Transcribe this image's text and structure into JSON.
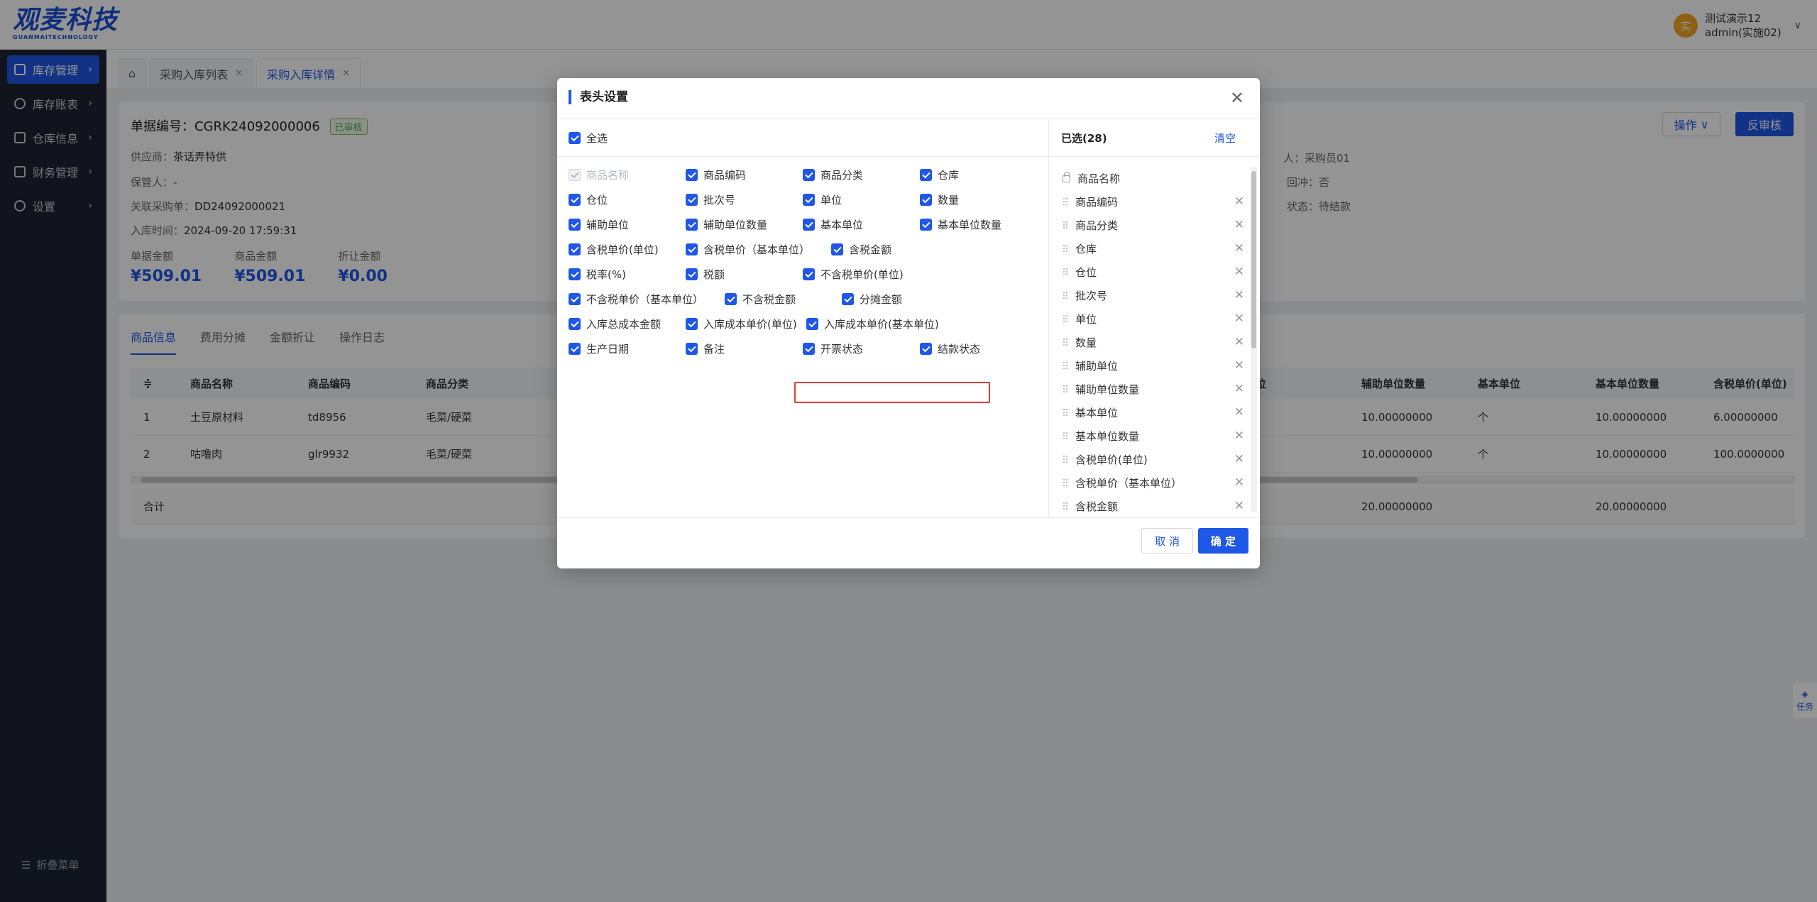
{
  "logo": {
    "cn": "观麦科技",
    "en": "GUANMAITECHNOLOGY"
  },
  "user": {
    "avatar": "实",
    "name": "测试演示12",
    "account": "admin(实施02)"
  },
  "sidebar": {
    "items": [
      {
        "label": "库存管理",
        "icon": "warehouse-icon",
        "active": true
      },
      {
        "label": "库存账表",
        "icon": "chart-icon"
      },
      {
        "label": "仓库信息",
        "icon": "store-icon"
      },
      {
        "label": "财务管理",
        "icon": "finance-icon"
      },
      {
        "label": "设置",
        "icon": "gear-icon"
      }
    ],
    "fold_label": "折叠菜单"
  },
  "tabs": [
    {
      "label": "采购入库列表"
    },
    {
      "label": "采购入库详情",
      "active": true
    }
  ],
  "info": {
    "title": "单据编号：CGRK24092000006",
    "status": "已审核",
    "supplier": "供应商：",
    "supplier_val": "茶话弄特供",
    "keeper": "保管人：-",
    "order_label": "关联采购单：",
    "order_val": "DD24092000021",
    "time_label": "入库时间：",
    "time_val": "2024-09-20 17:59:31",
    "amounts": [
      {
        "label": "单据金额",
        "value": "¥509.01"
      },
      {
        "label": "商品金额",
        "value": "¥509.01"
      },
      {
        "label": "折让金额",
        "value": "¥0.00"
      }
    ],
    "right": {
      "buyer": "人：采购员01",
      "reverse": "回冲：否",
      "settle": "状态：待结款"
    },
    "op_button": "操作",
    "reaudit_button": "反审核"
  },
  "detail": {
    "tabs": [
      "商品信息",
      "费用分摊",
      "金额折让",
      "操作日志"
    ],
    "columns": [
      "商品名称",
      "商品编码",
      "商品分类",
      "单位",
      "辅助单位数量",
      "基本单位",
      "基本单位数量",
      "含税单价(单位)"
    ],
    "rows": [
      {
        "idx": "1",
        "name": "土豆原材料",
        "code": "td8956",
        "cat": "毛菜/硬菜",
        "aux": "10.00000000",
        "base": "个",
        "basenum": "10.00000000",
        "price": "6.00000000"
      },
      {
        "idx": "2",
        "name": "咕噜肉",
        "code": "glr9932",
        "cat": "毛菜/硬菜",
        "aux": "10.00000000",
        "base": "个",
        "basenum": "10.00000000",
        "price": "100.0000000"
      }
    ],
    "total_label": "合计",
    "total_aux": "20.00000000",
    "total_base": "20.00000000"
  },
  "modal": {
    "title": "表头设置",
    "select_all": "全选",
    "options": [
      {
        "label": "商品名称",
        "disabled": true
      },
      {
        "label": "商品编码"
      },
      {
        "label": "商品分类"
      },
      {
        "label": "仓库"
      },
      {
        "label": "仓位"
      },
      {
        "label": "批次号"
      },
      {
        "label": "单位"
      },
      {
        "label": "数量"
      },
      {
        "label": "辅助单位"
      },
      {
        "label": "辅助单位数量"
      },
      {
        "label": "基本单位"
      },
      {
        "label": "基本单位数量"
      },
      {
        "label": "含税单价(单位)"
      },
      {
        "label": "含税单价（基本单位）"
      },
      {
        "label": "含税金额"
      },
      {
        "label": "税率(%)"
      },
      {
        "label": "税额"
      },
      {
        "label": "不含税单价(单位)"
      },
      {
        "label": "不含税单价（基本单位）"
      },
      {
        "label": "不含税金额"
      },
      {
        "label": "分摊金额"
      },
      {
        "label": "入库总成本金额"
      },
      {
        "label": "入库成本单价(单位)"
      },
      {
        "label": "入库成本单价(基本单位)"
      },
      {
        "label": "生产日期"
      },
      {
        "label": "备注"
      },
      {
        "label": "开票状态"
      },
      {
        "label": "结款状态"
      }
    ],
    "selected_count": "已选(28)",
    "clear": "清空",
    "selected": [
      "商品名称",
      "商品编码",
      "商品分类",
      "仓库",
      "仓位",
      "批次号",
      "单位",
      "数量",
      "辅助单位",
      "辅助单位数量",
      "基本单位",
      "基本单位数量",
      "含税单价(单位)",
      "含税单价（基本单位）",
      "含税金额"
    ],
    "cancel": "取 消",
    "ok": "确 定"
  },
  "task_label": "任务",
  "colors": {
    "primary": "#1f57e7",
    "sidebar": "#1e2332",
    "highlight": "#e53935"
  }
}
